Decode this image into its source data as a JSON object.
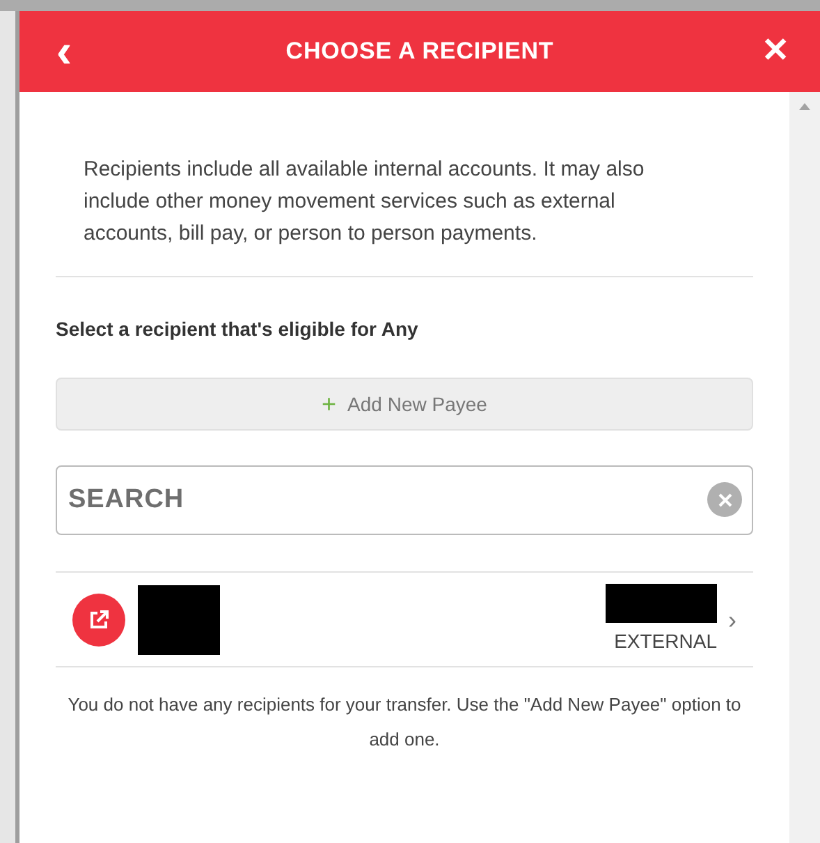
{
  "header": {
    "back": "‹",
    "title": "CHOOSE A RECIPIENT",
    "close": "✕"
  },
  "intro": "Recipients include all available internal accounts. It may also include other money movement services such as external accounts, bill pay, or person to person payments.",
  "eligibility": "Select a recipient that's eligible for Any",
  "add_button": {
    "icon": "+",
    "label": "Add New Payee"
  },
  "search": {
    "placeholder": "SEARCH"
  },
  "recipients": [
    {
      "type": "EXTERNAL",
      "chevron": "›"
    }
  ],
  "empty_message": "You do not have any recipients for your transfer. Use the \"Add New Payee\" option to add one."
}
